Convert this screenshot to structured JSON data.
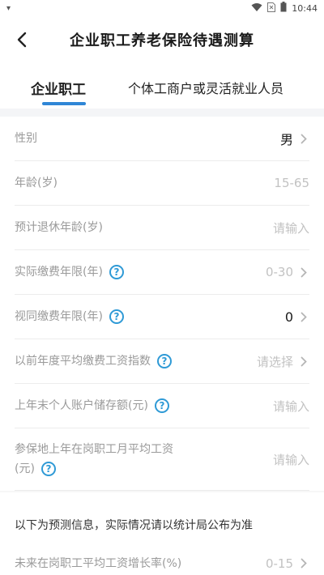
{
  "status": {
    "left": "▾",
    "time": "10:44",
    "icons": [
      "wifi-icon",
      "sim-icon",
      "battery-icon"
    ]
  },
  "header": {
    "title": "企业职工养老保险待遇测算"
  },
  "tabs": [
    {
      "label": "企业职工",
      "active": true
    },
    {
      "label": "个体工商户或灵活就业人员",
      "active": false
    }
  ],
  "form": {
    "rows": [
      {
        "label": "性别",
        "value": "男",
        "filled": true,
        "chevron": true,
        "help": false
      },
      {
        "label": "年龄(岁)",
        "value": "15-65",
        "filled": false,
        "chevron": false,
        "help": false
      },
      {
        "label": "预计退休年龄(岁)",
        "value": "请输入",
        "filled": false,
        "chevron": false,
        "help": false
      },
      {
        "label": "实际缴费年限(年)",
        "value": "0-30",
        "filled": false,
        "chevron": true,
        "help": true
      },
      {
        "label": "视同缴费年限(年)",
        "value": "0",
        "filled": true,
        "chevron": true,
        "help": true
      },
      {
        "label": "以前年度平均缴费工资指数",
        "value": "请选择",
        "filled": false,
        "chevron": true,
        "help": true
      },
      {
        "label": "上年末个人账户储存额(元)",
        "value": "请输入",
        "filled": false,
        "chevron": false,
        "help": true
      }
    ],
    "tall_row": {
      "label": "参保地上年在岗职工月平均工资",
      "label_line2": "(元)",
      "value": "请输入"
    },
    "notice": "以下为预测信息，实际情况请以统计局公布为准",
    "last_row": {
      "label": "未来在岗职工平均工资增长率(%)",
      "value": "0-15"
    }
  },
  "colors": {
    "accent": "#2f86d6",
    "help": "#2f9ad6",
    "label": "#9a9a9a",
    "placeholder": "#c2c2c2"
  }
}
